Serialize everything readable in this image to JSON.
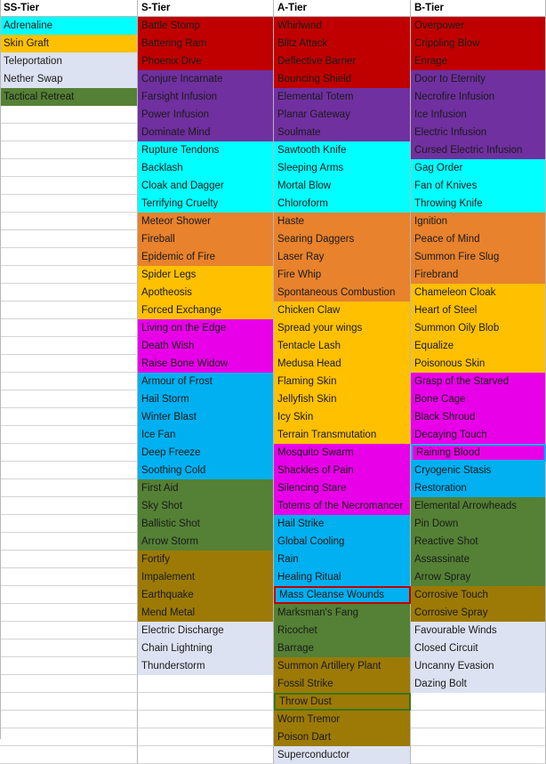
{
  "palette": {
    "cyan": "#00FFFF",
    "amber": "#FFC000",
    "lavender": "#DCE2F1",
    "green": "#548135",
    "red": "#C00000",
    "purple": "#7030A0",
    "orange": "#E8822C",
    "magenta": "#E800E8",
    "blue": "#00B0F0",
    "olive": "#9C7A05",
    "white": "#FFFFFF",
    "gridline": "#B7B7B7",
    "outline_red": "#C00000",
    "outline_green": "#38761D",
    "outline_cyan": "#00B0F0"
  },
  "columns": [
    {
      "key": "ss",
      "header": "SS-Tier",
      "rows": [
        {
          "label": "Adrenaline",
          "color": "cyan"
        },
        {
          "label": "Skin Graft",
          "color": "amber"
        },
        {
          "label": "Teleportation",
          "color": "lavender"
        },
        {
          "label": "Nether Swap",
          "color": "lavender"
        },
        {
          "label": "Tactical Retreat",
          "color": "green"
        },
        {
          "label": "",
          "color": "white"
        },
        {
          "label": "",
          "color": "white"
        },
        {
          "label": "",
          "color": "white"
        },
        {
          "label": "",
          "color": "white"
        },
        {
          "label": "",
          "color": "white"
        },
        {
          "label": "",
          "color": "white"
        },
        {
          "label": "",
          "color": "white"
        },
        {
          "label": "",
          "color": "white"
        },
        {
          "label": "",
          "color": "white"
        },
        {
          "label": "",
          "color": "white"
        },
        {
          "label": "",
          "color": "white"
        },
        {
          "label": "",
          "color": "white"
        },
        {
          "label": "",
          "color": "white"
        },
        {
          "label": "",
          "color": "white"
        },
        {
          "label": "",
          "color": "white"
        },
        {
          "label": "",
          "color": "white"
        },
        {
          "label": "",
          "color": "white"
        },
        {
          "label": "",
          "color": "white"
        },
        {
          "label": "",
          "color": "white"
        },
        {
          "label": "",
          "color": "white"
        },
        {
          "label": "",
          "color": "white"
        },
        {
          "label": "",
          "color": "white"
        },
        {
          "label": "",
          "color": "white"
        },
        {
          "label": "",
          "color": "white"
        },
        {
          "label": "",
          "color": "white"
        },
        {
          "label": "",
          "color": "white"
        },
        {
          "label": "",
          "color": "white"
        },
        {
          "label": "",
          "color": "white"
        },
        {
          "label": "",
          "color": "white"
        },
        {
          "label": "",
          "color": "white"
        },
        {
          "label": "",
          "color": "white"
        },
        {
          "label": "",
          "color": "white"
        },
        {
          "label": "",
          "color": "white"
        },
        {
          "label": "",
          "color": "white"
        },
        {
          "label": "",
          "color": "white"
        }
      ]
    },
    {
      "key": "s",
      "header": "S-Tier",
      "rows": [
        {
          "label": "Battle Stomp",
          "color": "red"
        },
        {
          "label": "Battering Ram",
          "color": "red"
        },
        {
          "label": "Phoenix Dive",
          "color": "red"
        },
        {
          "label": "Conjure Incarnate",
          "color": "purple"
        },
        {
          "label": "Farsight Infusion",
          "color": "purple"
        },
        {
          "label": "Power Infusion",
          "color": "purple"
        },
        {
          "label": "Dominate Mind",
          "color": "purple"
        },
        {
          "label": "Rupture Tendons",
          "color": "cyan"
        },
        {
          "label": "Backlash",
          "color": "cyan"
        },
        {
          "label": "Cloak and Dagger",
          "color": "cyan"
        },
        {
          "label": "Terrifying Cruelty",
          "color": "cyan"
        },
        {
          "label": "Meteor Shower",
          "color": "orange"
        },
        {
          "label": "Fireball",
          "color": "orange"
        },
        {
          "label": "Epidemic of Fire",
          "color": "orange"
        },
        {
          "label": "Spider Legs",
          "color": "amber"
        },
        {
          "label": "Apotheosis",
          "color": "amber"
        },
        {
          "label": "Forced Exchange",
          "color": "amber"
        },
        {
          "label": "Living on the Edge",
          "color": "magenta"
        },
        {
          "label": "Death Wish",
          "color": "magenta"
        },
        {
          "label": "Raise Bone Widow",
          "color": "magenta"
        },
        {
          "label": "Armour of Frost",
          "color": "blue"
        },
        {
          "label": "Hail Storm",
          "color": "blue"
        },
        {
          "label": "Winter Blast",
          "color": "blue"
        },
        {
          "label": "Ice Fan",
          "color": "blue"
        },
        {
          "label": "Deep Freeze",
          "color": "blue"
        },
        {
          "label": "Soothing Cold",
          "color": "blue"
        },
        {
          "label": "First Aid",
          "color": "green"
        },
        {
          "label": "Sky Shot",
          "color": "green"
        },
        {
          "label": "Ballistic Shot",
          "color": "green"
        },
        {
          "label": "Arrow Storm",
          "color": "green"
        },
        {
          "label": "Fortify",
          "color": "olive"
        },
        {
          "label": "Impalement",
          "color": "olive"
        },
        {
          "label": "Earthquake",
          "color": "olive"
        },
        {
          "label": "Mend Metal",
          "color": "olive"
        },
        {
          "label": "Electric Discharge",
          "color": "lavender"
        },
        {
          "label": "Chain Lightning",
          "color": "lavender"
        },
        {
          "label": "Thunderstorm",
          "color": "lavender"
        },
        {
          "label": "",
          "color": "white"
        },
        {
          "label": "",
          "color": "white"
        },
        {
          "label": "",
          "color": "white"
        }
      ]
    },
    {
      "key": "a",
      "header": "A-Tier",
      "rows": [
        {
          "label": "Whirlwind",
          "color": "red"
        },
        {
          "label": "Blitz Attack",
          "color": "red"
        },
        {
          "label": "Deflective Barrier",
          "color": "red"
        },
        {
          "label": "Bouncing Shield",
          "color": "red"
        },
        {
          "label": "Elemental Totem",
          "color": "purple"
        },
        {
          "label": "Planar Gateway",
          "color": "purple"
        },
        {
          "label": "Soulmate",
          "color": "purple"
        },
        {
          "label": "Sawtooth Knife",
          "color": "cyan"
        },
        {
          "label": "Sleeping Arms",
          "color": "cyan"
        },
        {
          "label": "Mortal Blow",
          "color": "cyan"
        },
        {
          "label": "Chloroform",
          "color": "cyan"
        },
        {
          "label": "Haste",
          "color": "orange"
        },
        {
          "label": "Searing Daggers",
          "color": "orange"
        },
        {
          "label": "Laser Ray",
          "color": "orange"
        },
        {
          "label": "Fire Whip",
          "color": "orange"
        },
        {
          "label": "Spontaneous Combustion",
          "color": "orange"
        },
        {
          "label": "Chicken Claw",
          "color": "amber"
        },
        {
          "label": "Spread your wings",
          "color": "amber"
        },
        {
          "label": "Tentacle Lash",
          "color": "amber"
        },
        {
          "label": "Medusa Head",
          "color": "amber"
        },
        {
          "label": "Flaming Skin",
          "color": "amber"
        },
        {
          "label": "Jellyfish Skin",
          "color": "amber"
        },
        {
          "label": "Icy Skin",
          "color": "amber"
        },
        {
          "label": "Terrain Transmutation",
          "color": "amber"
        },
        {
          "label": "Mosquito Swarm",
          "color": "magenta"
        },
        {
          "label": "Shackles of Pain",
          "color": "magenta"
        },
        {
          "label": "Silencing Stare",
          "color": "magenta"
        },
        {
          "label": "Totems of the Necromancer",
          "color": "magenta"
        },
        {
          "label": "Hail Strike",
          "color": "blue"
        },
        {
          "label": "Global Cooling",
          "color": "blue"
        },
        {
          "label": "Rain",
          "color": "blue"
        },
        {
          "label": "Healing Ritual",
          "color": "blue"
        },
        {
          "label": "Mass Cleanse Wounds",
          "color": "blue",
          "outline": "red"
        },
        {
          "label": "Marksman's Fang",
          "color": "green"
        },
        {
          "label": "Ricochet",
          "color": "green"
        },
        {
          "label": "Barrage",
          "color": "green"
        },
        {
          "label": "Summon Artillery Plant",
          "color": "olive"
        },
        {
          "label": "Fossil Strike",
          "color": "olive"
        },
        {
          "label": "Throw Dust",
          "color": "olive",
          "outline": "green"
        },
        {
          "label": "Worm Tremor",
          "color": "olive"
        }
      ]
    },
    {
      "key": "b",
      "header": "B-Tier",
      "rows": [
        {
          "label": "Overpower",
          "color": "red"
        },
        {
          "label": "Crippling Blow",
          "color": "red"
        },
        {
          "label": "Enrage",
          "color": "red"
        },
        {
          "label": "Door to Eternity",
          "color": "purple"
        },
        {
          "label": "Necrofire Infusion",
          "color": "purple"
        },
        {
          "label": "Ice Infusion",
          "color": "purple"
        },
        {
          "label": "Electric Infusion",
          "color": "purple"
        },
        {
          "label": "Cursed Electric Infusion",
          "color": "purple"
        },
        {
          "label": "Gag Order",
          "color": "cyan"
        },
        {
          "label": "Fan of Knives",
          "color": "cyan"
        },
        {
          "label": "Throwing Knife",
          "color": "cyan"
        },
        {
          "label": "Ignition",
          "color": "orange"
        },
        {
          "label": "Peace of Mind",
          "color": "orange"
        },
        {
          "label": "Summon Fire Slug",
          "color": "orange"
        },
        {
          "label": "Firebrand",
          "color": "orange"
        },
        {
          "label": "Chameleon Cloak",
          "color": "amber"
        },
        {
          "label": "Heart of Steel",
          "color": "amber"
        },
        {
          "label": "Summon Oily Blob",
          "color": "amber"
        },
        {
          "label": "Equalize",
          "color": "amber"
        },
        {
          "label": "Poisonous Skin",
          "color": "amber"
        },
        {
          "label": "Grasp of the Starved",
          "color": "magenta"
        },
        {
          "label": "Bone Cage",
          "color": "magenta"
        },
        {
          "label": "Black Shroud",
          "color": "magenta"
        },
        {
          "label": "Decaying Touch",
          "color": "magenta"
        },
        {
          "label": "Raining Blood",
          "color": "magenta",
          "outline": "cyan"
        },
        {
          "label": "Cryogenic Stasis",
          "color": "blue"
        },
        {
          "label": "Restoration",
          "color": "blue"
        },
        {
          "label": "Elemental Arrowheads",
          "color": "green"
        },
        {
          "label": "Pin Down",
          "color": "green"
        },
        {
          "label": "Reactive Shot",
          "color": "green"
        },
        {
          "label": "Assassinate",
          "color": "green"
        },
        {
          "label": "Arrow Spray",
          "color": "green"
        },
        {
          "label": "Corrosive Touch",
          "color": "olive"
        },
        {
          "label": "Corrosive Spray",
          "color": "olive"
        },
        {
          "label": "Favourable Winds",
          "color": "lavender"
        },
        {
          "label": "Closed Circuit",
          "color": "lavender"
        },
        {
          "label": "Uncanny Evasion",
          "color": "lavender"
        },
        {
          "label": "Dazing Bolt",
          "color": "lavender"
        },
        {
          "label": "",
          "color": "white"
        },
        {
          "label": "",
          "color": "white"
        }
      ]
    }
  ],
  "extra_rows": {
    "a_col_tail": [
      {
        "label": "Poison Dart",
        "color": "olive"
      },
      {
        "label": "Superconductor",
        "color": "lavender"
      }
    ]
  }
}
